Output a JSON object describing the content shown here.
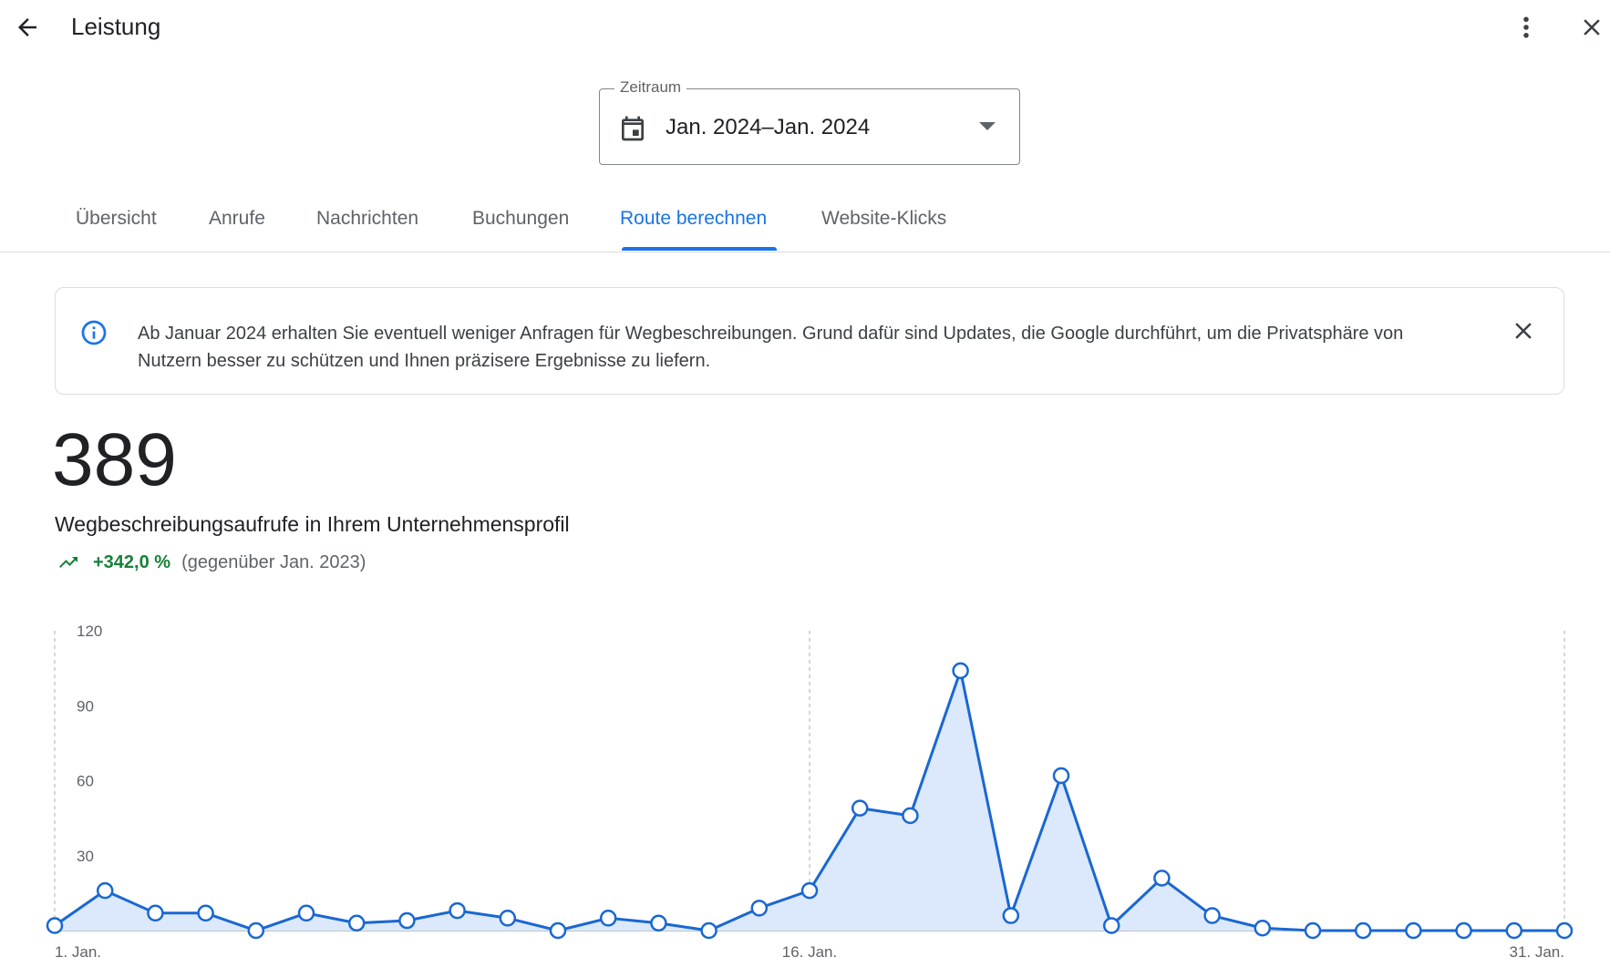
{
  "header": {
    "back_icon": "arrow-back-icon",
    "title": "Leistung",
    "more_icon": "more-vert-icon",
    "close_icon": "close-icon"
  },
  "date_range": {
    "label": "Zeitraum",
    "value": "Jan. 2024–Jan. 2024",
    "calendar_icon": "calendar-icon",
    "dropdown_icon": "arrow-drop-down-icon"
  },
  "tabs": [
    {
      "label": "Übersicht",
      "active": false
    },
    {
      "label": "Anrufe",
      "active": false
    },
    {
      "label": "Nachrichten",
      "active": false
    },
    {
      "label": "Buchungen",
      "active": false
    },
    {
      "label": "Route berechnen",
      "active": true
    },
    {
      "label": "Website-Klicks",
      "active": false
    }
  ],
  "banner": {
    "info_icon": "info-icon",
    "text": "Ab Januar 2024 erhalten Sie eventuell weniger Anfragen für Wegbeschreibungen. Grund dafür sind Updates, die Google durchführt, um die Privatsphäre von Nutzern besser zu schützen und Ihnen präzisere Ergebnisse zu liefern.",
    "close_icon": "close-icon"
  },
  "metric": {
    "value": "389",
    "label": "Wegbeschreibungsaufrufe in Ihrem Unternehmensprofil",
    "trend_icon": "trending-up-icon",
    "change": "+342,0 %",
    "comparison": "(gegenüber Jan. 2023)"
  },
  "colors": {
    "accent": "#1a73e8",
    "positive": "#188038",
    "line": "#1967d2",
    "area": "#dce8fb"
  },
  "chart_data": {
    "type": "area",
    "x": [
      1,
      2,
      3,
      4,
      5,
      6,
      7,
      8,
      9,
      10,
      11,
      12,
      13,
      14,
      15,
      16,
      17,
      18,
      19,
      20,
      21,
      22,
      23,
      24,
      25,
      26,
      27,
      28,
      29,
      30,
      31
    ],
    "series": [
      {
        "values": [
          2,
          16,
          7,
          7,
          0,
          7,
          3,
          4,
          8,
          5,
          0,
          5,
          3,
          0,
          9,
          16,
          49,
          46,
          104,
          6,
          62,
          2,
          21,
          6,
          1,
          0,
          0,
          0,
          0,
          0,
          0
        ]
      }
    ],
    "x_tick_labels": [
      "1. Jan.",
      "16. Jan.",
      "31. Jan."
    ],
    "x_tick_positions": [
      1,
      16,
      31
    ],
    "y_ticks": [
      30,
      60,
      90,
      120
    ],
    "ylim": [
      0,
      120
    ],
    "vertical_gridlines_at": [
      1,
      16,
      31
    ],
    "grid": "dashed vertical"
  }
}
